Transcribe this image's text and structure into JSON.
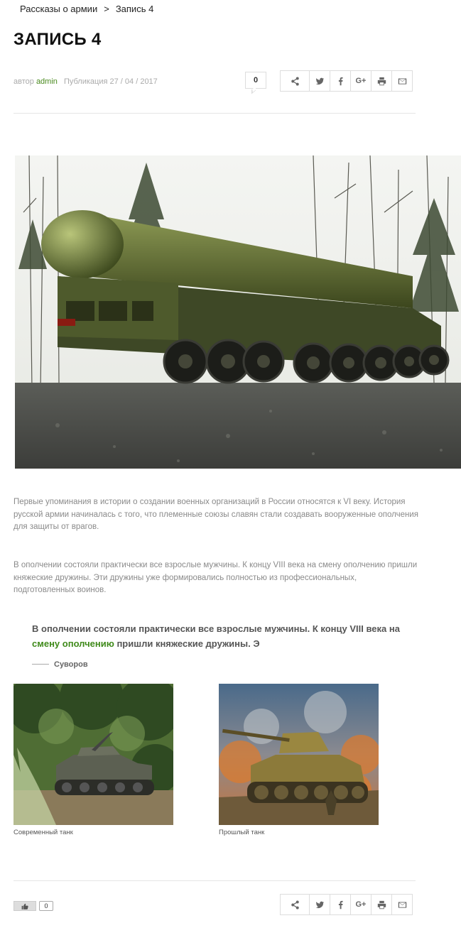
{
  "breadcrumb": {
    "parent": "Рассказы о армии",
    "separator": ">",
    "current": "Запись 4"
  },
  "article": {
    "title": "ЗАПИСЬ 4",
    "meta": {
      "author_prefix": "автор",
      "author": "admin",
      "published_prefix": "Публикация",
      "date": "27 / 04 / 2017"
    },
    "comment_count": "0",
    "paragraphs": [
      "Первые упоминания в истории о создании военных организаций в России относятся к VI веку. История русской армии начиналась с того, что племенные союзы славян стали создавать вооруженные ополчения для защиты от врагов.",
      "В ополчении состояли практически все взрослые мужчины. К концу VIII века на смену ополчению пришли княжеские дружины. Эти дружины уже формировались полностью из профессиональных, подготовленных воинов."
    ],
    "quote": {
      "before": "В ополчении состояли практически все взрослые мужчины. К концу VIII века на ",
      "highlight": "смену ополчению",
      "after": " пришли княжеские дружины. Э",
      "author": "Суворов"
    },
    "figures": [
      {
        "caption": "Современный танк"
      },
      {
        "caption": "Прошлый танк"
      }
    ]
  },
  "share": {
    "icons": [
      "share-icon",
      "twitter-icon",
      "facebook-icon",
      "google-plus-icon",
      "print-icon",
      "email-icon"
    ],
    "google_plus_label": "G+"
  },
  "likes": {
    "count": "0"
  },
  "colors": {
    "accent": "#3f8a1a",
    "text_muted": "#8a8a8a",
    "border": "#dddddd"
  }
}
